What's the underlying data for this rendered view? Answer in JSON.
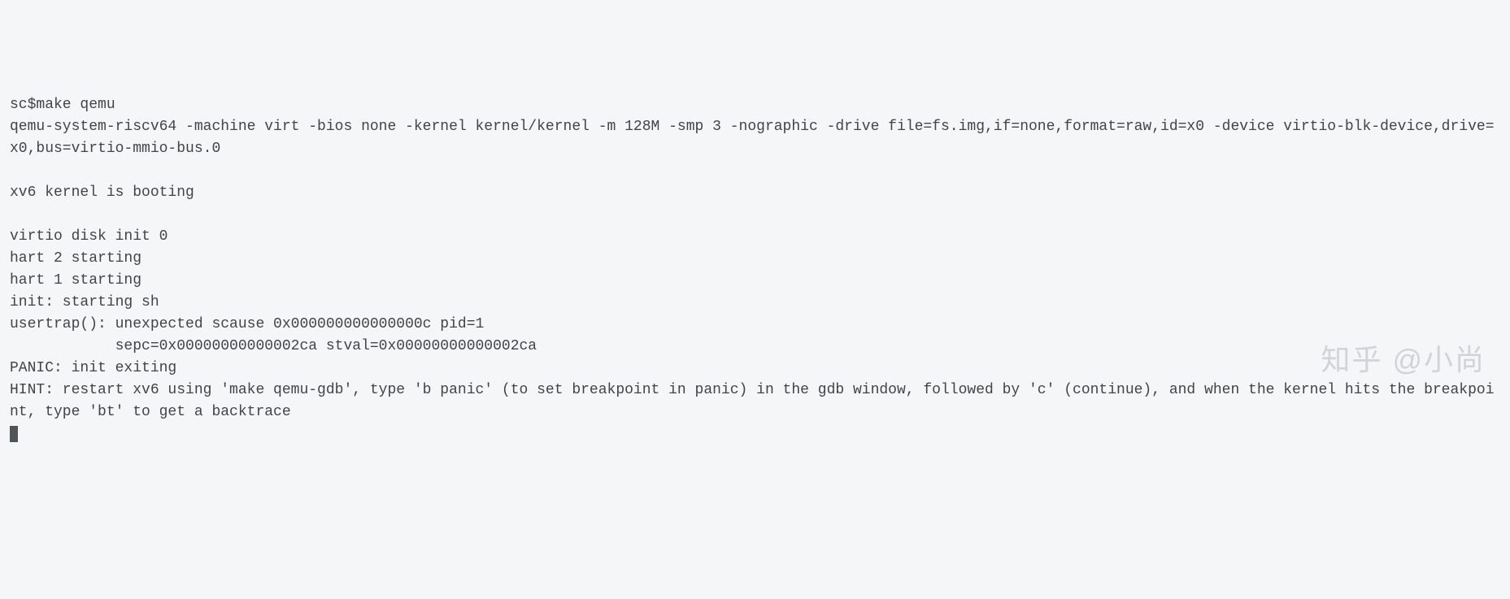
{
  "terminal": {
    "prompt": "sc$",
    "command": "make qemu",
    "lines": [
      "qemu-system-riscv64 -machine virt -bios none -kernel kernel/kernel -m 128M -smp 3 -nographic -drive file=fs.img,if=none,format=raw,id=x0 -device virtio-blk-device,drive=x0,bus=virtio-mmio-bus.0",
      "",
      "xv6 kernel is booting",
      "",
      "virtio disk init 0",
      "hart 2 starting",
      "hart 1 starting",
      "init: starting sh",
      "usertrap(): unexpected scause 0x000000000000000c pid=1",
      "            sepc=0x00000000000002ca stval=0x00000000000002ca",
      "PANIC: init exiting",
      "HINT: restart xv6 using 'make qemu-gdb', type 'b panic' (to set breakpoint in panic) in the gdb window, followed by 'c' (continue), and when the kernel hits the breakpoint, type 'bt' to get a backtrace"
    ]
  },
  "watermark": "知乎 @小尚"
}
